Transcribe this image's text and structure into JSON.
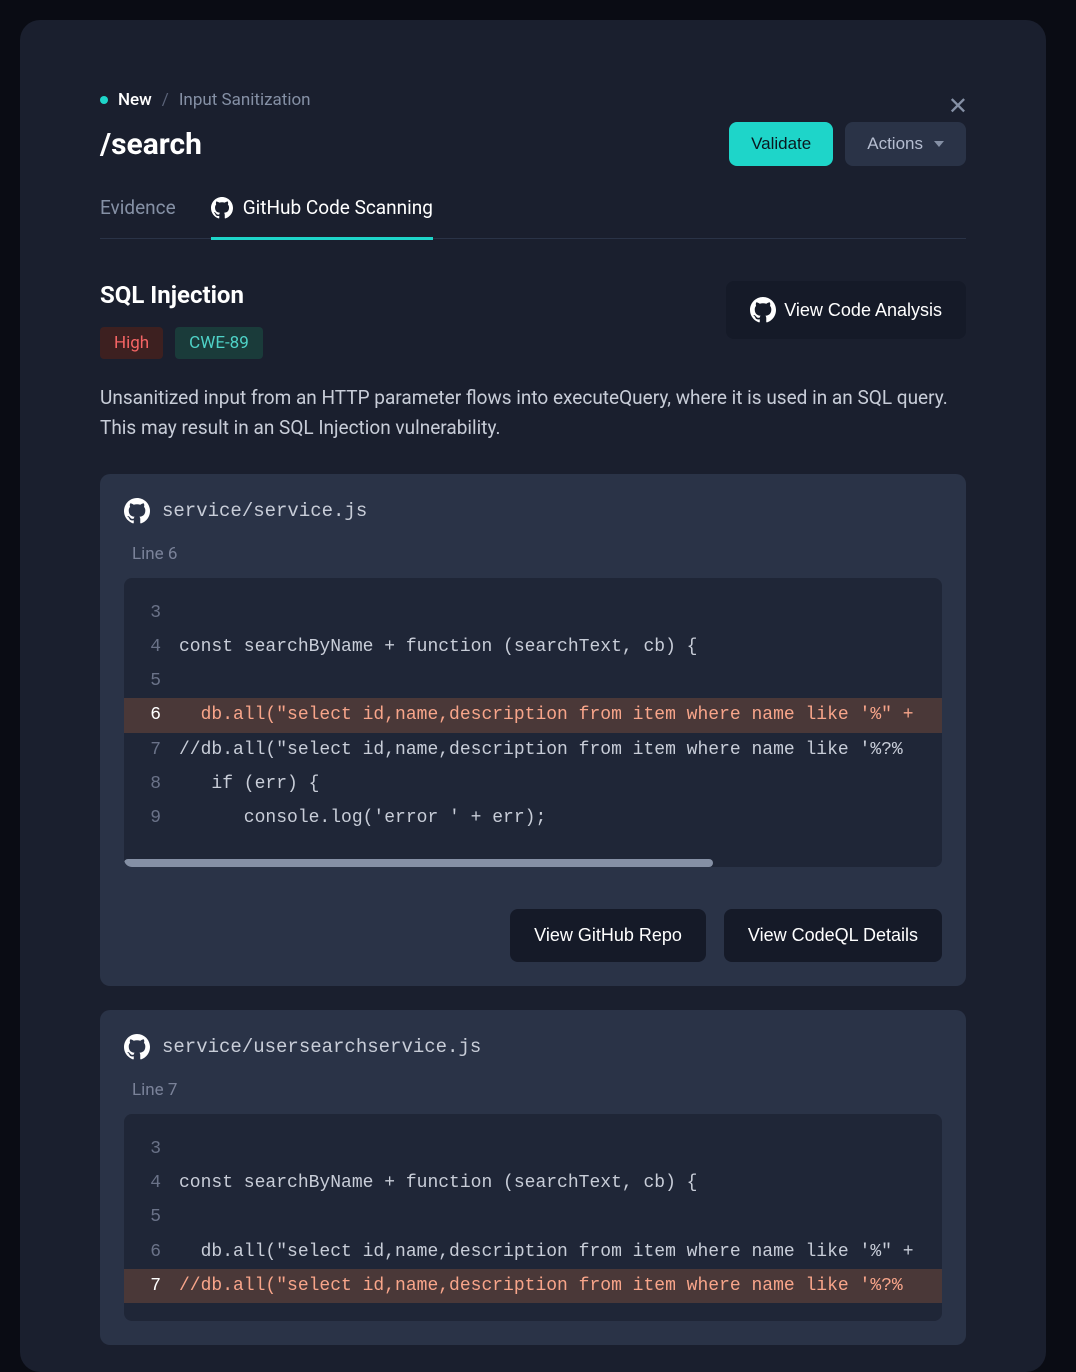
{
  "breadcrumb": {
    "status": "New",
    "page": "Input Sanitization"
  },
  "header": {
    "title": "/search",
    "validate_btn": "Validate",
    "actions_btn": "Actions"
  },
  "tabs": {
    "evidence": "Evidence",
    "github_scan": "GitHub Code Scanning"
  },
  "vuln": {
    "title": "SQL Injection",
    "severity": "High",
    "cwe": "CWE-89",
    "view_code_btn": "View Code Analysis",
    "description": "Unsanitized input from an HTTP parameter flows into executeQuery, where it is used in an SQL query. This may result in an SQL Injection vulnerability."
  },
  "card1": {
    "filename": "service/service.js",
    "line_label": "Line 6",
    "highlight_line": 6,
    "lines": [
      {
        "num": "3",
        "content": ""
      },
      {
        "num": "4",
        "content": "const searchByName + function (searchText, cb) {"
      },
      {
        "num": "5",
        "content": ""
      },
      {
        "num": "6",
        "content": "  db.all(\"select id,name,description from item where name like '%\" +"
      },
      {
        "num": "7",
        "content": "//db.all(\"select id,name,description from item where name like '%?%"
      },
      {
        "num": "8",
        "content": "   if (err) {"
      },
      {
        "num": "9",
        "content": "      console.log('error ' + err);"
      }
    ],
    "view_repo_btn": "View GitHub Repo",
    "view_codeql_btn": "View CodeQL Details"
  },
  "card2": {
    "filename": "service/usersearchservice.js",
    "line_label": "Line 7",
    "highlight_line": 7,
    "lines": [
      {
        "num": "3",
        "content": ""
      },
      {
        "num": "4",
        "content": "const searchByName + function (searchText, cb) {"
      },
      {
        "num": "5",
        "content": ""
      },
      {
        "num": "6",
        "content": "  db.all(\"select id,name,description from item where name like '%\" +"
      },
      {
        "num": "7",
        "content": "//db.all(\"select id,name,description from item where name like '%?%"
      }
    ]
  }
}
